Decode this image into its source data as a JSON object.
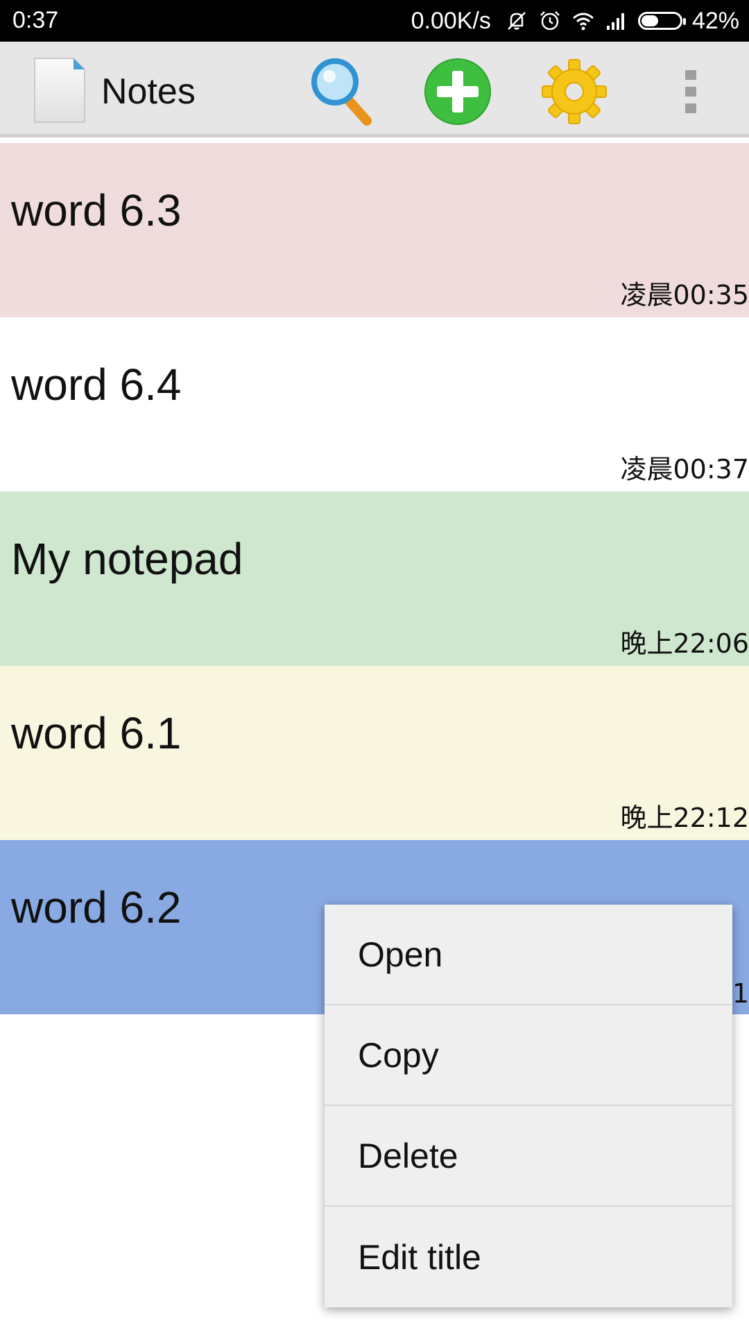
{
  "status_bar": {
    "time": "0:37",
    "net_speed": "0.00K/s",
    "battery": "42%",
    "battery_level": 0.42,
    "icons": [
      "mute-icon",
      "alarm-icon",
      "wifi-icon",
      "signal-icon",
      "battery-icon"
    ]
  },
  "app_bar": {
    "title": "Notes",
    "actions": [
      "search-icon",
      "add-icon",
      "settings-icon",
      "more-icon"
    ]
  },
  "notes": [
    {
      "title": "word 6.3",
      "time": "凌晨00:35",
      "color": "#f0dcdc"
    },
    {
      "title": "word 6.4",
      "time": "凌晨00:37",
      "color": "#ffffff"
    },
    {
      "title": "My notepad",
      "time": "晚上22:06",
      "color": "#cfe6cf"
    },
    {
      "title": "word 6.1",
      "time": "晚上22:12",
      "color": "#f8f6df"
    },
    {
      "title": "word 6.2",
      "time": "1",
      "color": "#88a9e2"
    }
  ],
  "context_menu": {
    "items": [
      "Open",
      "Copy",
      "Delete",
      "Edit title"
    ]
  }
}
